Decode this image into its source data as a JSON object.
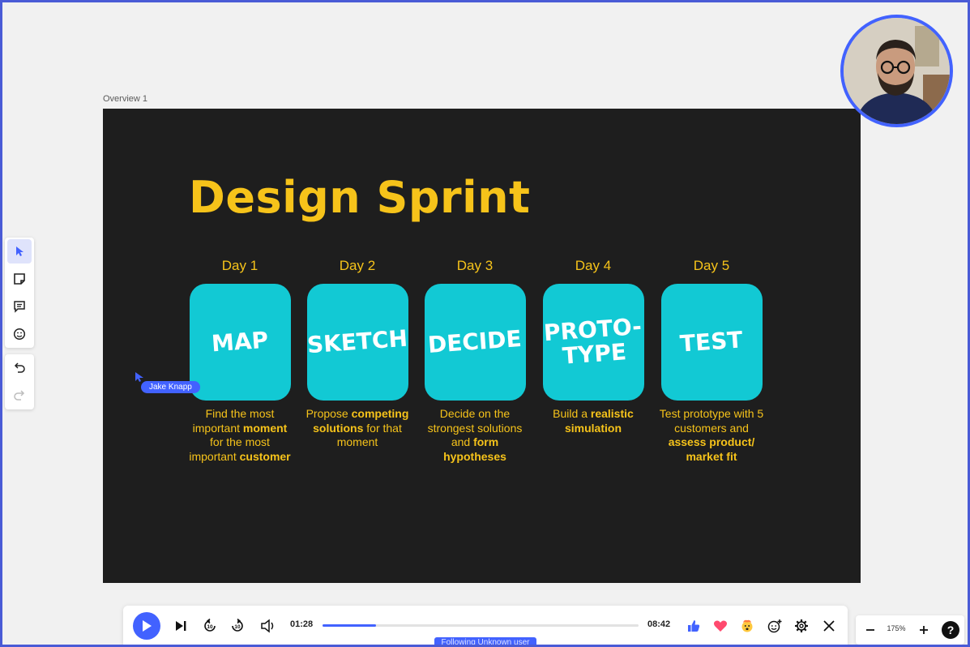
{
  "frame": {
    "label": "Overview 1"
  },
  "slide": {
    "title": "Design Sprint",
    "days": [
      {
        "label": "Day 1",
        "word": "MAP",
        "desc_html": "Find the most important <b>moment</b> for the most important <b>customer</b>"
      },
      {
        "label": "Day 2",
        "word": "SKETCH",
        "desc_html": "Propose <b>competing solutions</b> for that moment"
      },
      {
        "label": "Day 3",
        "word": "DECIDE",
        "desc_html": "Decide on the strongest solutions and <b>form hypotheses</b>"
      },
      {
        "label": "Day 4",
        "word": "PROTO-\nTYPE",
        "desc_html": "Build a <b>realistic simulation</b>"
      },
      {
        "label": "Day 5",
        "word": "TEST",
        "desc_html": "Test prototype with 5 customers and <b>assess product/ market fit</b>"
      }
    ]
  },
  "cursor": {
    "user": "Jake Knapp"
  },
  "player": {
    "current_time": "01:28",
    "total_time": "08:42",
    "progress": 0.17,
    "following": "Following Unknown user"
  },
  "zoom": {
    "level": "175%"
  },
  "help": {
    "label": "?"
  },
  "colors": {
    "accent": "#4262ff",
    "slide_bg": "#1e1e1e",
    "title": "#f6c31a",
    "card": "#12c9d4"
  }
}
